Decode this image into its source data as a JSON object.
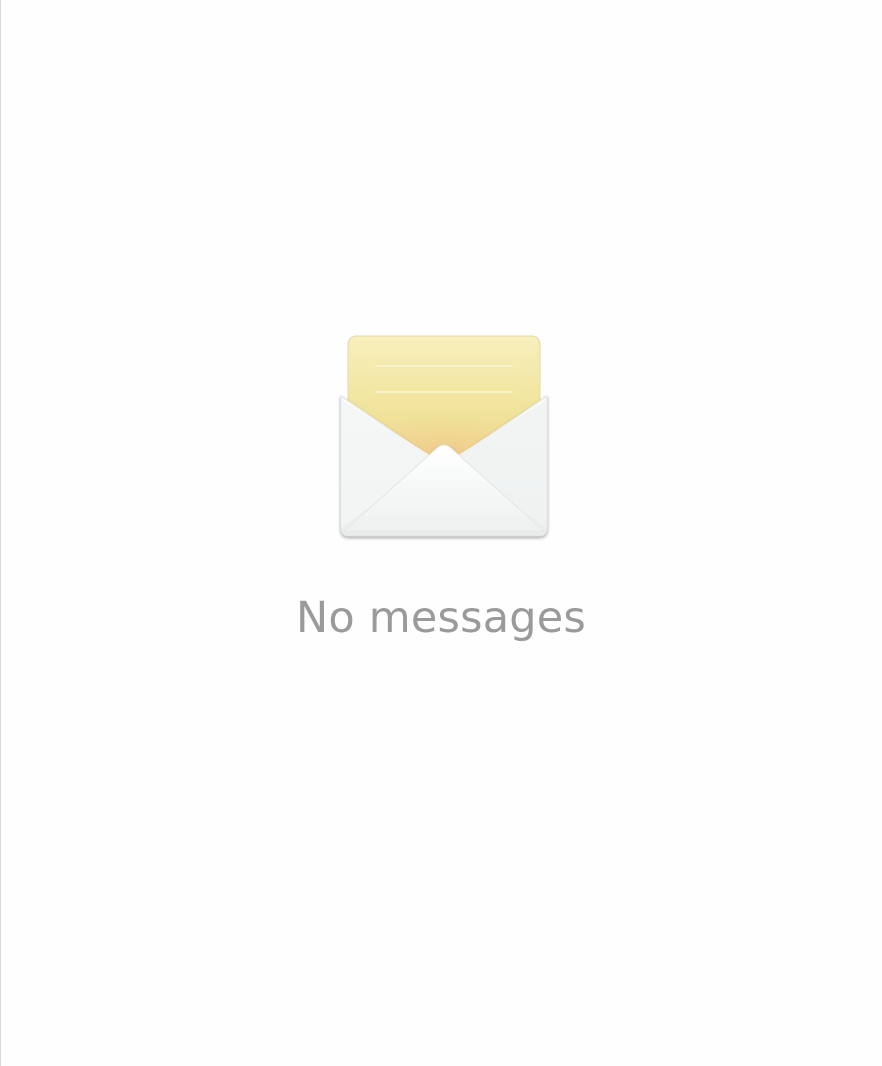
{
  "empty_state": {
    "icon": "open-envelope-icon",
    "message": "No messages",
    "colors": {
      "text": "#9a9a9a",
      "letter": "#f4e8a8",
      "envelope": "#f2f3f3",
      "background": "#fefefe"
    }
  }
}
